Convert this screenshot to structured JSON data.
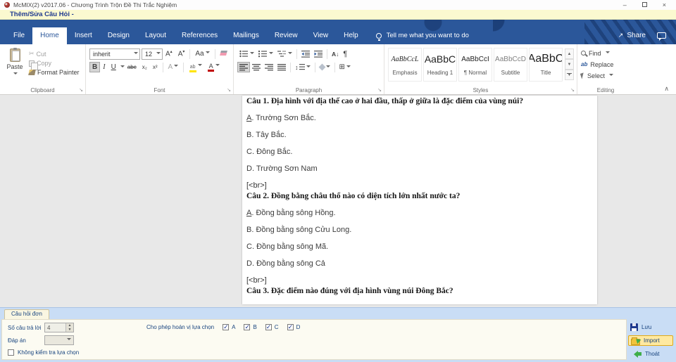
{
  "window": {
    "title": "McMIX(2) v2017.06 - Chương Trình Trộn Đề Thi Trắc Nghiệm",
    "minimize": "–",
    "close": "×"
  },
  "menubar": {
    "title": "Thêm/Sửa Câu Hỏi -"
  },
  "ribbon": {
    "tabs": [
      "File",
      "Home",
      "Insert",
      "Design",
      "Layout",
      "References",
      "Mailings",
      "Review",
      "View",
      "Help"
    ],
    "active_tab": "Home",
    "tell_me": "Tell me what you want to do",
    "share": "Share",
    "clipboard": {
      "label": "Clipboard",
      "paste": "Paste",
      "cut": "Cut",
      "copy": "Copy",
      "format_painter": "Format Painter"
    },
    "font": {
      "label": "Font",
      "name_value": "inherit",
      "size_value": "12",
      "bold": "B",
      "italic": "I",
      "underline": "U",
      "strikethrough": "abc",
      "subscript": "x₂",
      "superscript": "x²",
      "change_case": "Aa",
      "grow": "A",
      "shrink": "A",
      "text_effects": "A",
      "font_color": "A"
    },
    "paragraph": {
      "label": "Paragraph",
      "sort": "A↓",
      "pilcrow": "¶"
    },
    "styles": {
      "label": "Styles",
      "items": [
        {
          "preview": "AaBbCcL",
          "name": "Emphasis",
          "kind": "emphasis"
        },
        {
          "preview": "AaBbC",
          "name": "Heading 1",
          "kind": "heading1"
        },
        {
          "preview": "AaBbCcI",
          "name": "¶ Normal",
          "kind": "normal"
        },
        {
          "preview": "AaBbCcD",
          "name": "Subtitle",
          "kind": "subtitle"
        },
        {
          "preview": "AaBbC",
          "name": "Title",
          "kind": "title"
        }
      ]
    },
    "editing": {
      "label": "Editing",
      "find": "Find",
      "replace": "Replace",
      "select": "Select"
    }
  },
  "document": {
    "blocks": [
      {
        "type": "question",
        "text": "Câu 1. Địa hình với địa thế cao ở hai đầu, thấp ở giữa là đặc điểm của vùng núi?"
      },
      {
        "type": "option",
        "letter": "A",
        "text": ". Trường Sơn Bắc.",
        "underline": true
      },
      {
        "type": "option",
        "letter": "B",
        "text": ". Tây Bắc.",
        "underline": false
      },
      {
        "type": "option",
        "letter": "C",
        "text": ". Đông Bắc.",
        "underline": false
      },
      {
        "type": "option",
        "letter": "D",
        "text": ". Trường Sơn Nam",
        "underline": false
      },
      {
        "type": "break",
        "text": "[<br>]"
      },
      {
        "type": "question",
        "text": "Câu 2. Đồng bằng châu thổ nào có diện tích lớn nhất nước ta?"
      },
      {
        "type": "option",
        "letter": "A",
        "text": ". Đồng bằng sông Hồng.",
        "underline": true
      },
      {
        "type": "option",
        "letter": "B",
        "text": ". Đồng bằng sông Cửu Long.",
        "underline": false
      },
      {
        "type": "option",
        "letter": "C",
        "text": ". Đồng bằng sông Mã.",
        "underline": false
      },
      {
        "type": "option",
        "letter": "D",
        "text": ". Đồng bằng sông Cả",
        "underline": false
      },
      {
        "type": "break",
        "text": "[<br>]"
      },
      {
        "type": "question",
        "text": "Câu 3. Đặc điểm nào đúng với địa hình vùng núi Đông Bắc?"
      }
    ]
  },
  "bottom_panel": {
    "tab": "Câu hỏi đơn",
    "answers_count_label": "Số câu trả lời",
    "answers_count_value": "4",
    "answer_key_label": "Đáp án",
    "skip_check_label": "Không kiểm tra lựa chọn",
    "skip_check_checked": false,
    "permute_label": "Cho phép hoán vị lựa chọn",
    "permute_options": [
      {
        "letter": "A",
        "checked": true
      },
      {
        "letter": "B",
        "checked": true
      },
      {
        "letter": "C",
        "checked": true
      },
      {
        "letter": "D",
        "checked": true
      }
    ],
    "save_label": "Lưu",
    "import_label": "Import",
    "exit_label": "Thoát"
  },
  "colors": {
    "ribbon_blue": "#2b579a",
    "menubar_yellow": "#fbf9d0",
    "panel_blue": "#c9ddf5",
    "label_navy": "#17437e",
    "import_highlight": "#ffe9a0",
    "font_color_bar": "#c00000",
    "highlight_bar": "#ffe400"
  }
}
